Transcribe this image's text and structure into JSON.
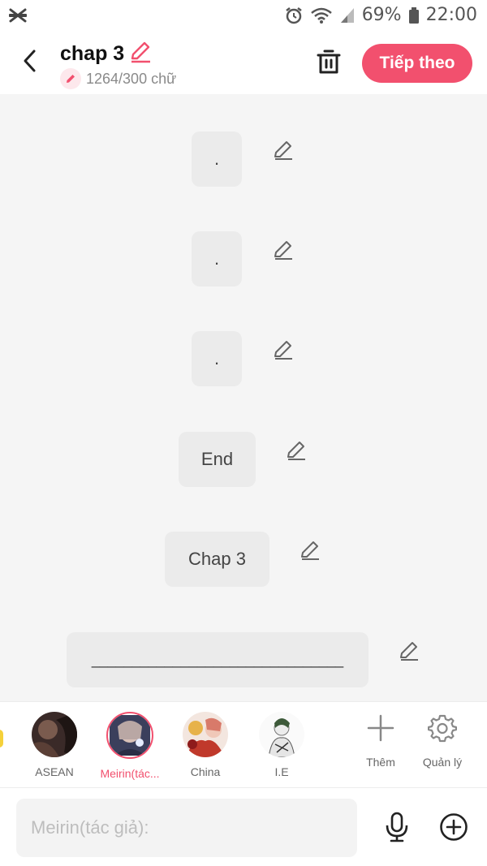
{
  "status_bar": {
    "battery": "69%",
    "time": "22:00",
    "icons": [
      "capcut-icon",
      "alarm-icon",
      "wifi-icon",
      "signal-icon",
      "battery-icon"
    ]
  },
  "header": {
    "title": "chap 3",
    "word_count": "1264/300 chữ",
    "next_label": "Tiếp theo"
  },
  "messages": [
    {
      "text": "."
    },
    {
      "text": "."
    },
    {
      "text": "."
    },
    {
      "text": "End"
    },
    {
      "text": "Chap 3"
    },
    {
      "text": "_______________________________"
    }
  ],
  "characters": [
    {
      "name": "ASEAN"
    },
    {
      "name": "Meirin(tác..."
    },
    {
      "name": "China"
    },
    {
      "name": "I.E"
    }
  ],
  "tools": {
    "add_label": "Thêm",
    "manage_label": "Quản lý"
  },
  "input": {
    "placeholder": "Meirin(tác giả):"
  },
  "colors": {
    "accent": "#f2506e",
    "bubble": "#ebebeb",
    "background": "#f5f5f5"
  }
}
